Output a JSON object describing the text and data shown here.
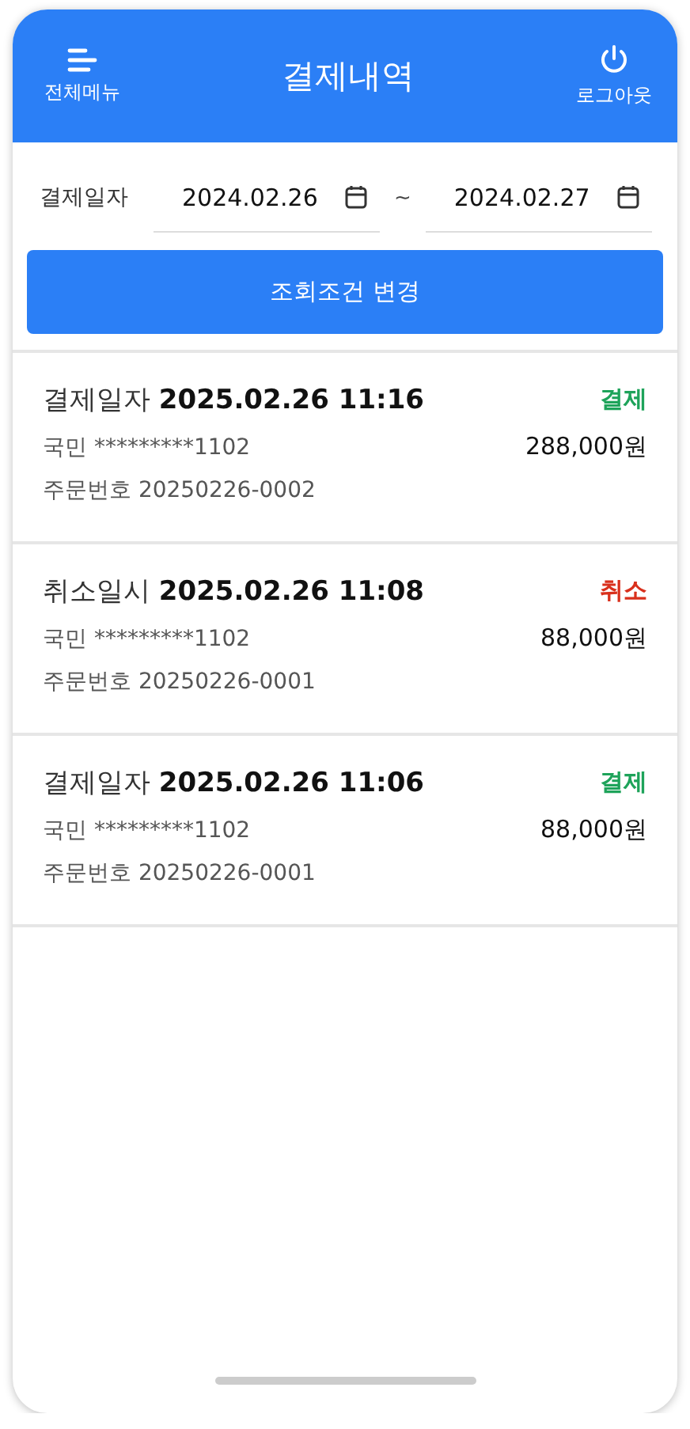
{
  "header": {
    "menu_label": "전체메뉴",
    "title": "결제내역",
    "logout_label": "로그아웃"
  },
  "filter": {
    "label": "결제일자",
    "from": "2024.02.26",
    "separator": "~",
    "to": "2024.02.27",
    "button": "조회조건 변경"
  },
  "transactions": [
    {
      "date_label": "결제일자",
      "datetime": "2025.02.26 11:16",
      "status": "결제",
      "color": "#1ea35a",
      "card": "국민 *********1102",
      "amount": "288,000원",
      "order": "주문번호 20250226-0002"
    },
    {
      "date_label": "취소일시",
      "datetime": "2025.02.26 11:08",
      "status": "취소",
      "color": "#d9301c",
      "card": "국민 *********1102",
      "amount": "88,000원",
      "order": "주문번호 20250226-0001"
    },
    {
      "date_label": "결제일자",
      "datetime": "2025.02.26 11:06",
      "status": "결제",
      "color": "#1ea35a",
      "card": "국민 *********1102",
      "amount": "88,000원",
      "order": "주문번호 20250226-0001"
    }
  ]
}
